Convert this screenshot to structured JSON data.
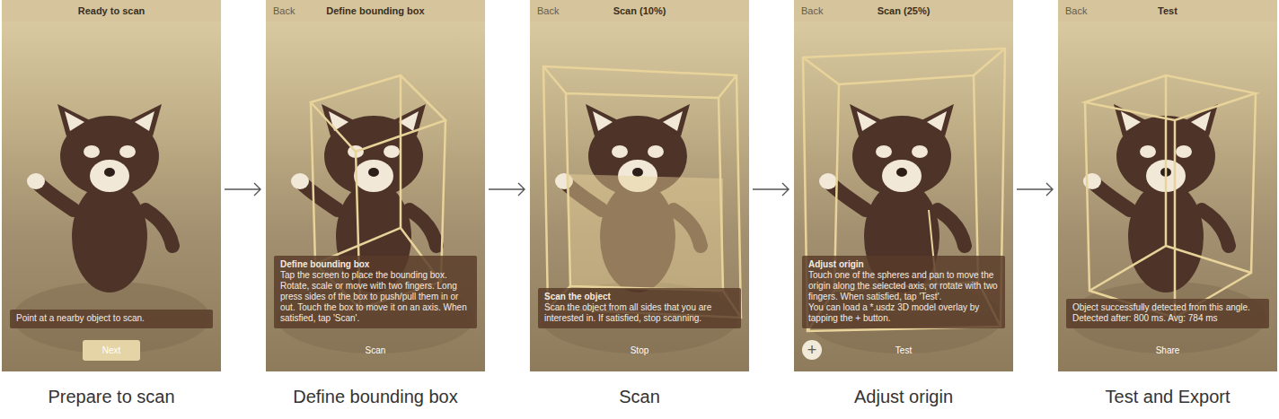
{
  "screens": [
    {
      "title": "Ready to scan",
      "heading": "",
      "body": [
        "Point at a nearby object to scan."
      ],
      "button": {
        "label": "Next",
        "kind": "filled"
      },
      "caption": "Prepare to scan"
    },
    {
      "title": "Define bounding box",
      "back": "Back",
      "heading": "Define bounding box",
      "body": [
        "Tap the screen to place the bounding box. Rotate, scale or move with two fingers. Long press sides of the box to push/pull them in or out. Touch the box to move it on an axis. When satisfied, tap 'Scan'."
      ],
      "button": {
        "label": "Scan",
        "kind": "plain"
      },
      "caption": "Define bounding box"
    },
    {
      "title": "Scan (10%)",
      "back": "Back",
      "heading": "Scan the object",
      "body": [
        "Scan the object from all sides that you are interested in. If satisfied, stop scanning."
      ],
      "button": {
        "label": "Stop",
        "kind": "plain"
      },
      "caption": "Scan"
    },
    {
      "title": "Scan (25%)",
      "back": "Back",
      "heading": "Adjust origin",
      "body": [
        "Touch one of the spheres and pan to move the origin along the selected axis, or rotate with two fingers. When satisfied, tap 'Test'.",
        "You can load a *.usdz 3D model overlay by tapping the + button."
      ],
      "add": "+",
      "button": {
        "label": "Test",
        "kind": "plain"
      },
      "caption": "Adjust origin"
    },
    {
      "title": "Test",
      "back": "Back",
      "heading": "",
      "body": [
        "Object successfully detected from this angle. Detected after: 800 ms. Avg: 784 ms"
      ],
      "button": {
        "label": "Share",
        "kind": "plain"
      },
      "caption": "Test and Export"
    }
  ]
}
